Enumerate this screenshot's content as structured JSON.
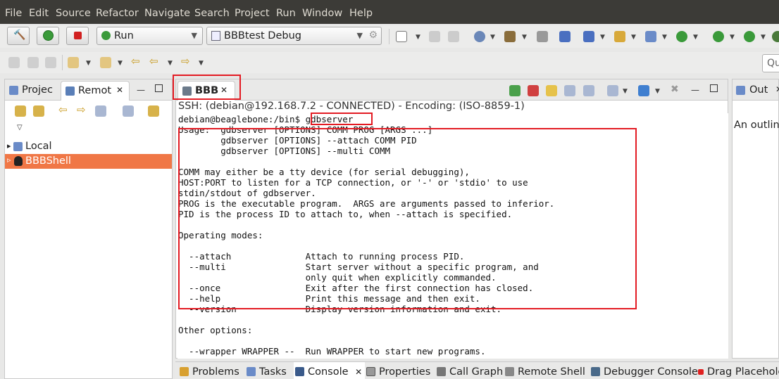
{
  "menu": {
    "file": "File",
    "edit": "Edit",
    "source": "Source",
    "refactor": "Refactor",
    "navigate": "Navigate",
    "search": "Search",
    "project": "Project",
    "run": "Run",
    "window": "Window",
    "help": "Help"
  },
  "toolbar": {
    "launch_mode": "Run",
    "launch_config": "BBBtest Debug",
    "quick_access_placeholder": "Qu"
  },
  "left_pane": {
    "tab_project": "Projec",
    "tab_remote": "Remot",
    "tree": [
      {
        "label": "Local",
        "expander": "▸"
      },
      {
        "label": "BBBShell",
        "expander": "▹"
      }
    ]
  },
  "center_pane": {
    "tab_label": "BBB",
    "ssh_status": "SSH: (debian@192.168.7.2 - CONNECTED) - Encoding: (ISO-8859-1)",
    "terminal_lines": [
      "debian@beaglebone:/bin$ gdbserver",
      "Usage:  gdbserver [OPTIONS] COMM PROG [ARGS ...]",
      "        gdbserver [OPTIONS] --attach COMM PID",
      "        gdbserver [OPTIONS] --multi COMM",
      "",
      "COMM may either be a tty device (for serial debugging),",
      "HOST:PORT to listen for a TCP connection, or '-' or 'stdio' to use",
      "stdin/stdout of gdbserver.",
      "PROG is the executable program.  ARGS are arguments passed to inferior.",
      "PID is the process ID to attach to, when --attach is specified.",
      "",
      "Operating modes:",
      "",
      "  --attach              Attach to running process PID.",
      "  --multi               Start server without a specific program, and",
      "                        only quit when explicitly commanded.",
      "  --once                Exit after the first connection has closed.",
      "  --help                Print this message and then exit.",
      "  --version             Display version information and exit.",
      "",
      "Other options:",
      "",
      "  --wrapper WRAPPER --  Run WRAPPER to start new programs."
    ]
  },
  "right_pane": {
    "tab_label": "Out",
    "message": "An outlin"
  },
  "bottom_tabs": [
    {
      "label": "Problems",
      "icon": "problems-icon"
    },
    {
      "label": "Tasks",
      "icon": "tasks-icon"
    },
    {
      "label": "Console",
      "icon": "console-icon"
    },
    {
      "label": "Properties",
      "icon": "properties-icon"
    },
    {
      "label": "Call Graph",
      "icon": "call-graph-icon"
    },
    {
      "label": "Remote Shell",
      "icon": "remote-shell-icon"
    },
    {
      "label": "Debugger Console",
      "icon": "debugger-console-icon"
    },
    {
      "label": "Drag Placehold",
      "icon": "drag-placeholder-icon"
    }
  ],
  "colors": {
    "menubar_bg": "#3c3b37",
    "selection": "#f07746",
    "highlight_border": "#e31b23"
  }
}
